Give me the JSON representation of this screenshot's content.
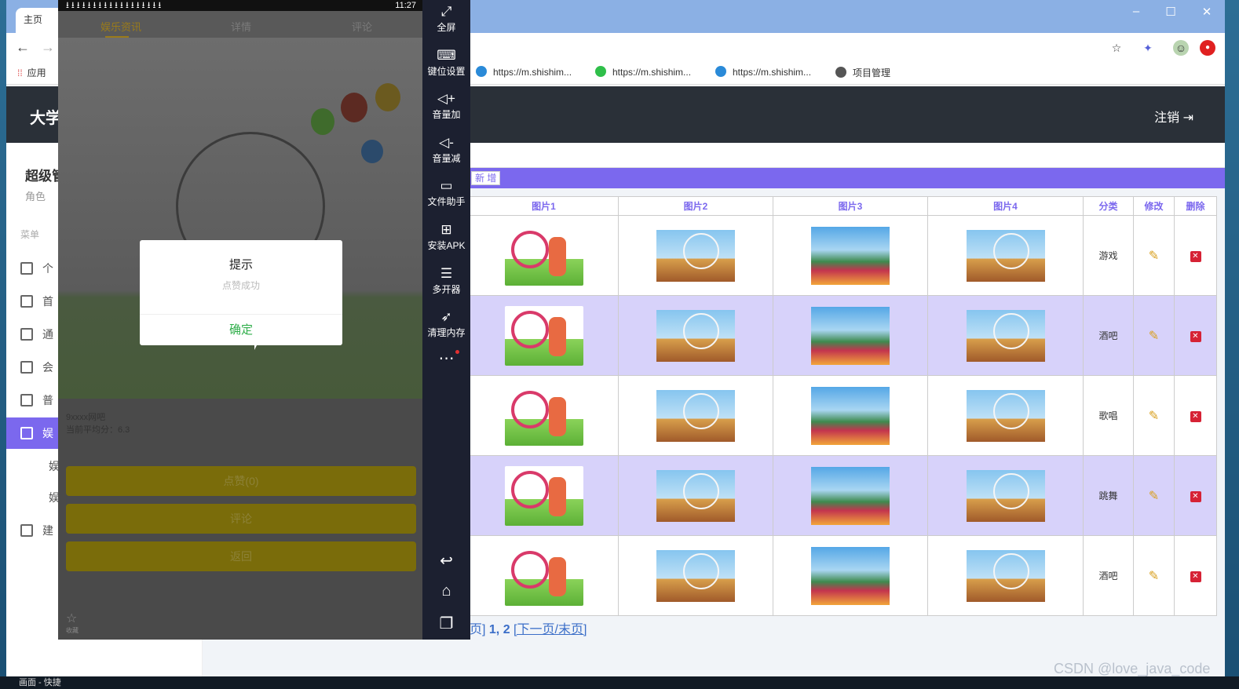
{
  "browser": {
    "tab_title": "主页",
    "tab_favicon": "BD",
    "apps_label": "应用",
    "bookmarks": [
      {
        "label": "https://m.shishim...",
        "color": "#2a8ad8"
      },
      {
        "label": "https://m.shishim...",
        "color": "#2fbf4a"
      },
      {
        "label": "https://m.shishim...",
        "color": "#2a8ad8"
      },
      {
        "label": "项目管理",
        "color": "#555555"
      }
    ]
  },
  "app": {
    "brand": "大学",
    "logout": "注销",
    "sidebar": {
      "title": "超级管",
      "role": "角色",
      "menu_heading": "菜单",
      "items": [
        "个",
        "首",
        "通",
        "会",
        "普",
        "娱",
        "建"
      ],
      "subitems": [
        "娱",
        "娱"
      ]
    },
    "add_button": "新 增",
    "table": {
      "headers": [
        "图片1",
        "图片2",
        "图片3",
        "图片4",
        "分类",
        "修改",
        "删除"
      ],
      "rows": [
        {
          "category": "游戏"
        },
        {
          "category": "酒吧"
        },
        {
          "category": "歌唱"
        },
        {
          "category": "跳舞"
        },
        {
          "category": "酒吧"
        }
      ]
    },
    "pager": {
      "prefix": "页]",
      "pages": "1, 2",
      "next": "[下一页/末页]"
    },
    "watermark": "CSDN @love_java_code",
    "taskbar_text": "画面 - 快捷"
  },
  "phone": {
    "time": "11:27",
    "tabs": [
      "娱乐资讯",
      "详情",
      "评论"
    ],
    "venue": "9xxxx网吧",
    "score": "当前平均分：6.3",
    "buttons": [
      "点赞(0)",
      "评论",
      "返回"
    ],
    "favorite": "收藏",
    "dialog": {
      "title": "提示",
      "message": "点赞成功",
      "ok": "确定"
    }
  },
  "emulator_toolbar": [
    {
      "icon": "fullscreen-icon",
      "glyph": "⤢",
      "label": "全屏"
    },
    {
      "icon": "keyboard-icon",
      "glyph": "⌨",
      "label": "键位设置"
    },
    {
      "icon": "volume-up-icon",
      "glyph": "🔈",
      "label": "音量加"
    },
    {
      "icon": "volume-down-icon",
      "glyph": "🔉",
      "label": "音量减"
    },
    {
      "icon": "file-helper-icon",
      "glyph": "▭",
      "label": "文件助手"
    },
    {
      "icon": "install-apk-icon",
      "glyph": "⊞",
      "label": "安装APK"
    },
    {
      "icon": "multi-instance-icon",
      "glyph": "☰",
      "label": "多开器"
    },
    {
      "icon": "clean-memory-icon",
      "glyph": "➶",
      "label": "清理内存"
    }
  ],
  "colors": {
    "accent": "#7b68ee",
    "header": "#2a3038",
    "delete": "#d62235"
  }
}
